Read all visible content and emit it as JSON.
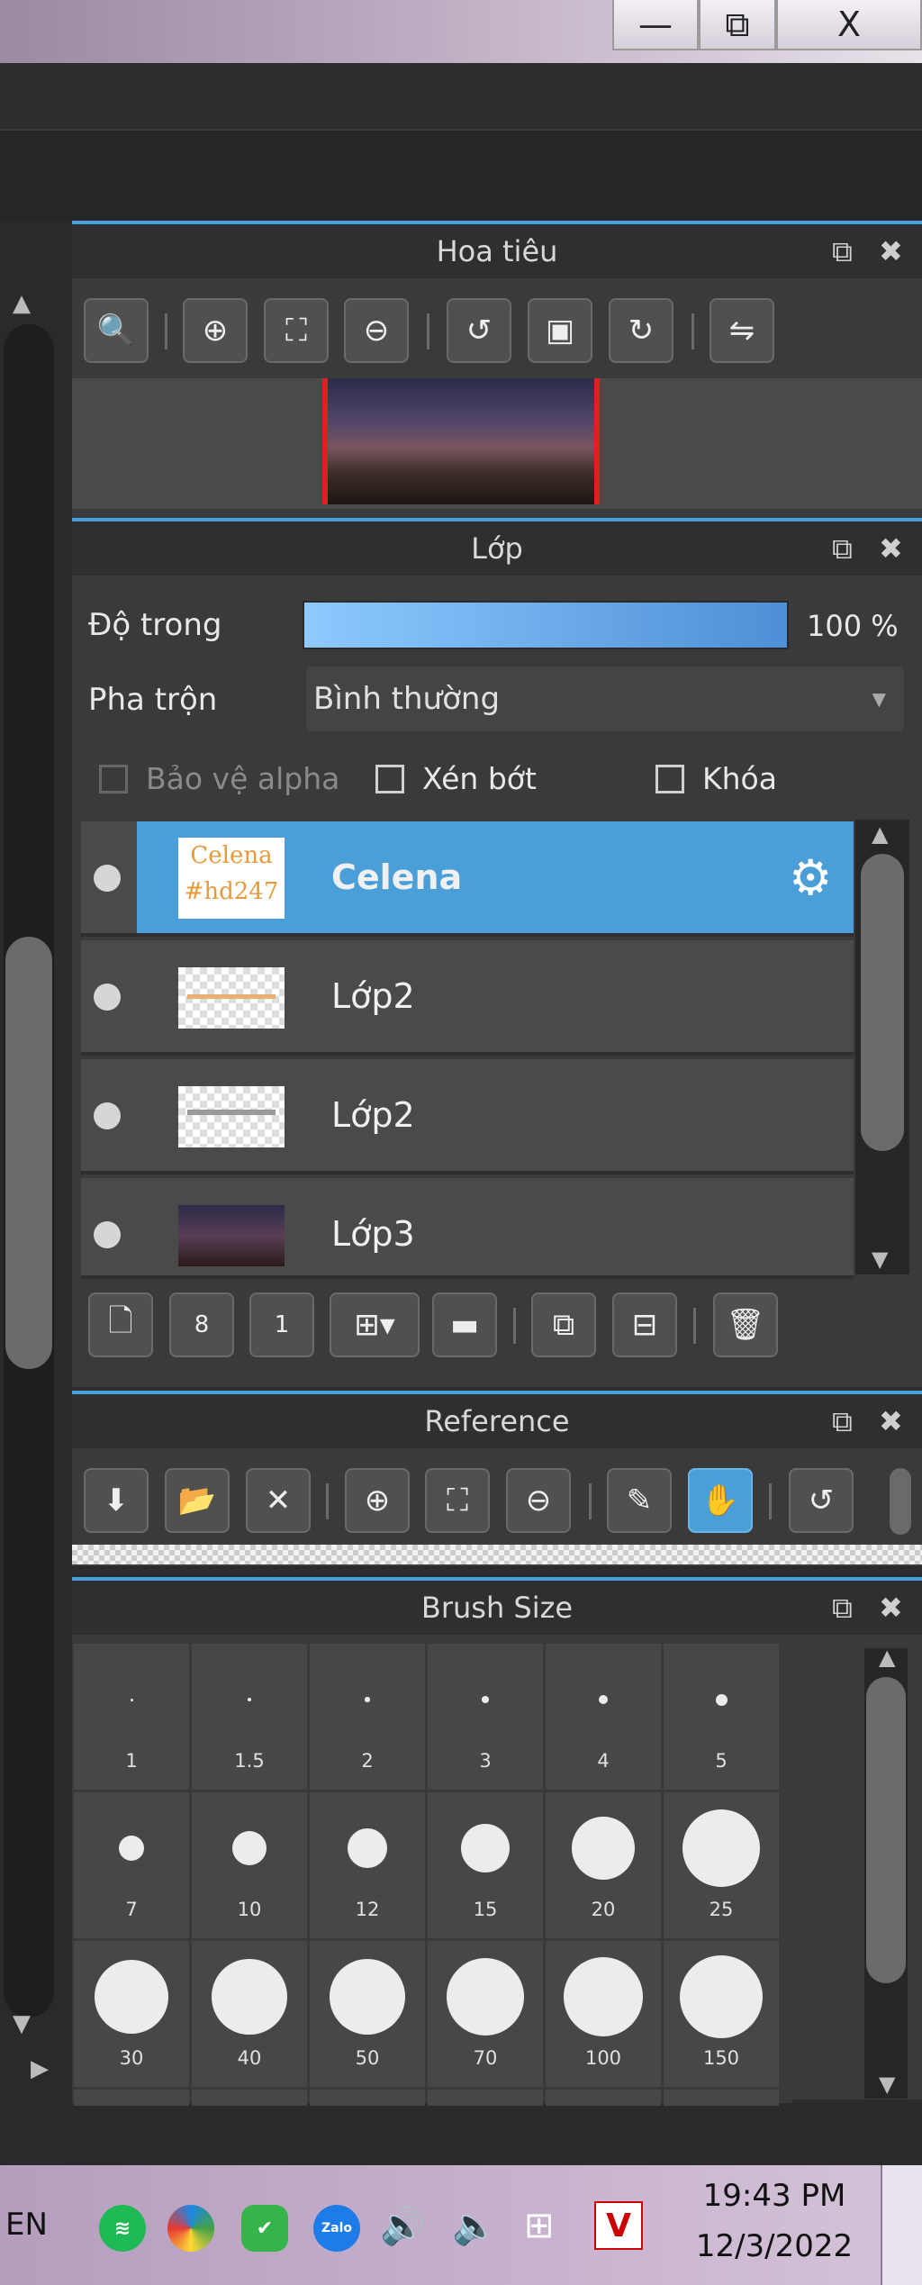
{
  "window": {
    "minimize_glyph": "—",
    "maximize_glyph": "⧉",
    "close_glyph": "X"
  },
  "navigator": {
    "title": "Hoa tiêu",
    "tools": [
      "zoom-actual-icon",
      "zoom-in-icon",
      "fit-screen-icon",
      "zoom-out-icon",
      "rotate-left-icon",
      "fit-frame-icon",
      "rotate-right-icon",
      "flip-icon"
    ]
  },
  "layers": {
    "title": "Lớp",
    "opacity_label": "Độ trong",
    "opacity_value": "100 %",
    "opacity_fraction": 1.0,
    "blend_label": "Pha trộn",
    "blend_value": "Bình thường",
    "protect_alpha": "Bảo vệ alpha",
    "clipping": "Xén bớt",
    "lock": "Khóa",
    "thumb_text_1": "Celena",
    "thumb_text_2": "#hd247",
    "items": [
      {
        "name": "Celena",
        "selected": true
      },
      {
        "name": "Lớp2",
        "selected": false
      },
      {
        "name": "Lớp2",
        "selected": false
      },
      {
        "name": "Lớp3",
        "selected": false
      }
    ]
  },
  "reference": {
    "title": "Reference"
  },
  "brush_size": {
    "title": "Brush Size",
    "sizes": [
      "1",
      "1.5",
      "2",
      "3",
      "4",
      "5",
      "7",
      "10",
      "12",
      "15",
      "20",
      "25",
      "30",
      "40",
      "50",
      "70",
      "100",
      "150"
    ]
  },
  "taskbar": {
    "language": "EN",
    "zalo_label": "Zalo",
    "time": "19:43 PM",
    "date": "12/3/2022"
  },
  "colors": {
    "accent": "#4a9fe0",
    "selected_layer": "#4a9fd8",
    "panel_bg": "#3a3a3a"
  }
}
